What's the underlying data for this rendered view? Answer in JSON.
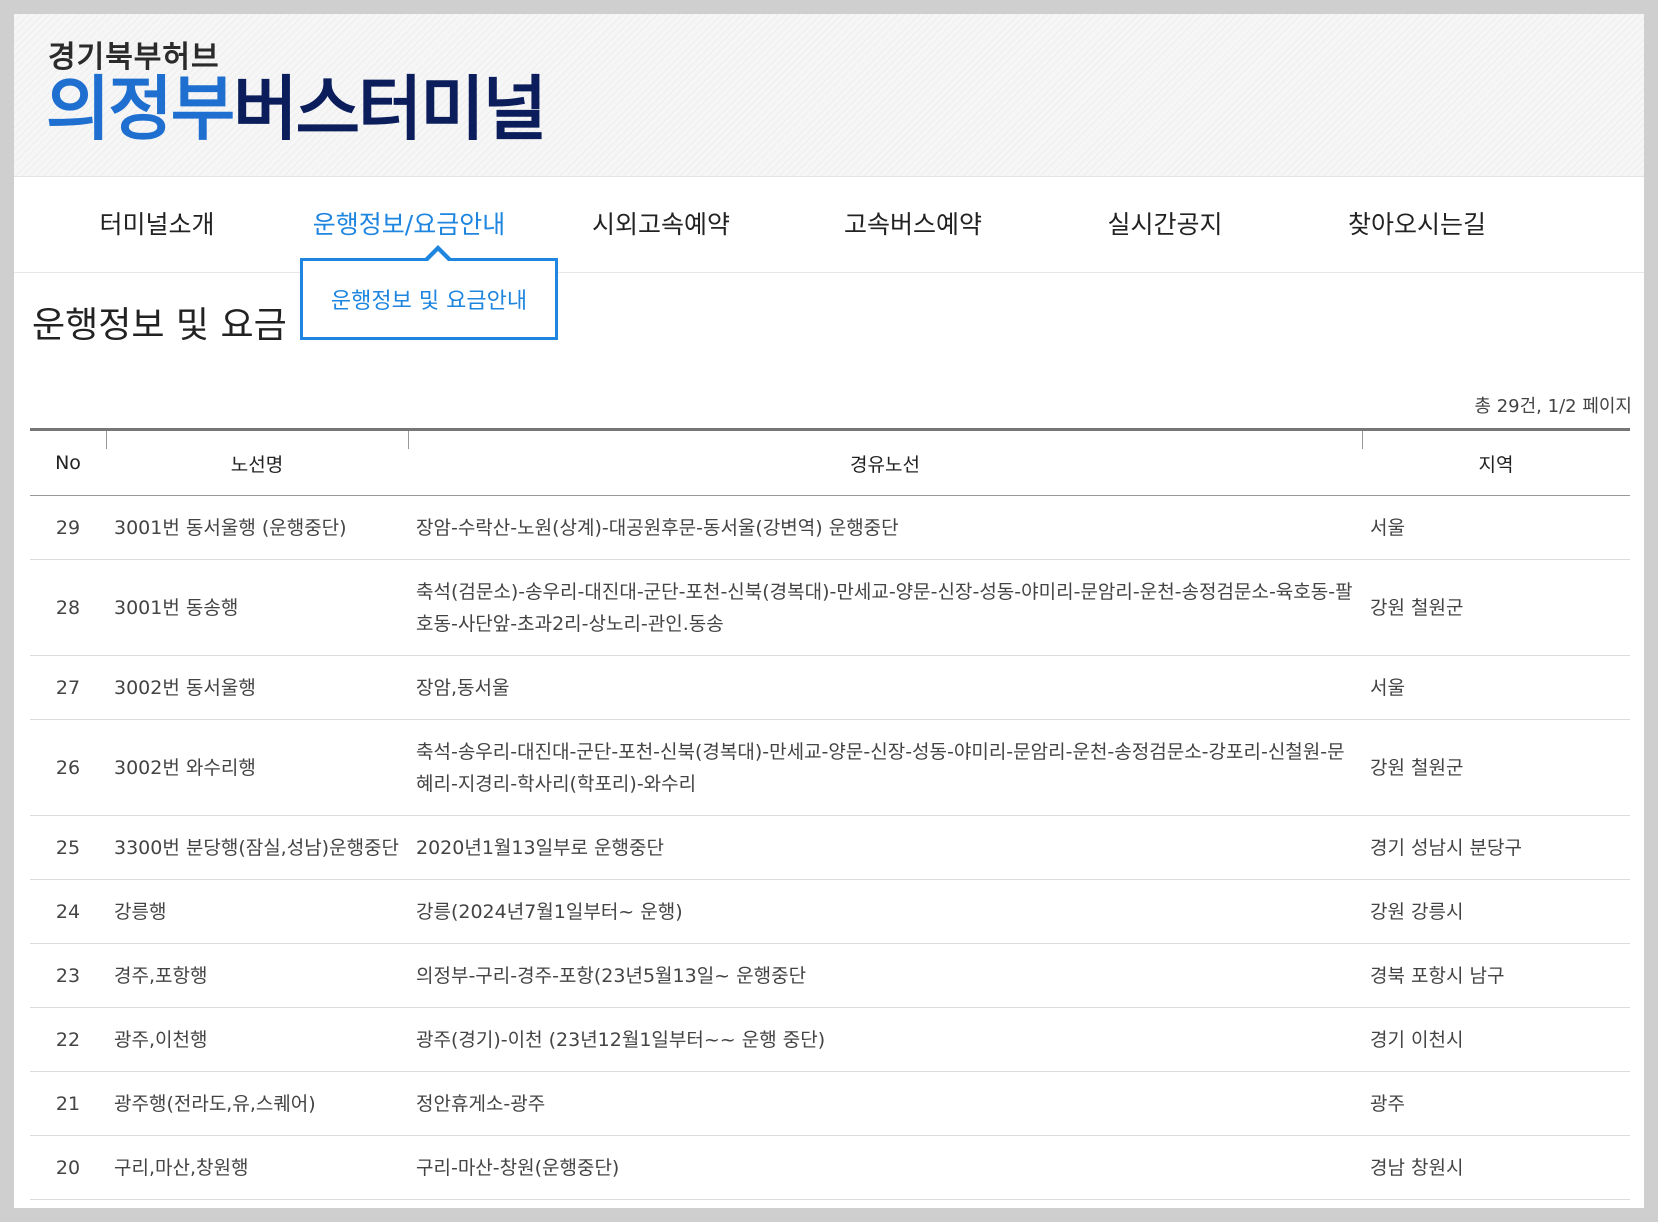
{
  "header": {
    "logo_sub": "경기북부허브",
    "logo_main_a": "의정부",
    "logo_main_b": "버스터미널"
  },
  "nav": {
    "items": [
      "터미널소개",
      "운행정보/요금안내",
      "시외고속예약",
      "고속버스예약",
      "실시간공지",
      "찾아오시는길"
    ],
    "active_index": 1,
    "dropdown_item": "운행정보 및 요금안내"
  },
  "page_title": "운행정보 및 요금",
  "total_info": "총 29건, 1/2 페이지",
  "table": {
    "headers": [
      "No",
      "노선명",
      "경유노선",
      "지역"
    ],
    "rows": [
      {
        "no": "29",
        "name": "3001번 동서울행 (운행중단)",
        "route": "장암-수락산-노원(상계)-대공원후문-동서울(강변역) 운행중단",
        "region": "서울"
      },
      {
        "no": "28",
        "name": "3001번 동송행",
        "route": "축석(검문소)-송우리-대진대-군단-포천-신북(경복대)-만세교-양문-신장-성동-야미리-문암리-운천-송정검문소-육호동-팔호동-사단앞-초과2리-상노리-관인.동송",
        "region": "강원 철원군"
      },
      {
        "no": "27",
        "name": "3002번 동서울행",
        "route": "장암,동서울",
        "region": "서울"
      },
      {
        "no": "26",
        "name": "3002번 와수리행",
        "route": "축석-송우리-대진대-군단-포천-신북(경복대)-만세교-양문-신장-성동-야미리-문암리-운천-송정검문소-강포리-신철원-문혜리-지경리-학사리(학포리)-와수리",
        "region": "강원 철원군"
      },
      {
        "no": "25",
        "name": "3300번 분당행(잠실,성남)운행중단",
        "route": "2020년1월13일부로 운행중단",
        "region": "경기 성남시 분당구"
      },
      {
        "no": "24",
        "name": "강릉행",
        "route": "강릉(2024년7월1일부터~ 운행)",
        "region": "강원 강릉시"
      },
      {
        "no": "23",
        "name": "경주,포항행",
        "route": "의정부-구리-경주-포항(23년5월13일~ 운행중단",
        "region": "경북 포항시 남구"
      },
      {
        "no": "22",
        "name": "광주,이천행",
        "route": "광주(경기)-이천 (23년12월1일부터~~ 운행 중단)",
        "region": "경기 이천시"
      },
      {
        "no": "21",
        "name": "광주행(전라도,유,스퀘어)",
        "route": "정안휴게소-광주",
        "region": "광주"
      },
      {
        "no": "20",
        "name": "구리,마산,창원행",
        "route": "구리-마산-창원(운행중단)",
        "region": "경남 창원시"
      }
    ]
  }
}
